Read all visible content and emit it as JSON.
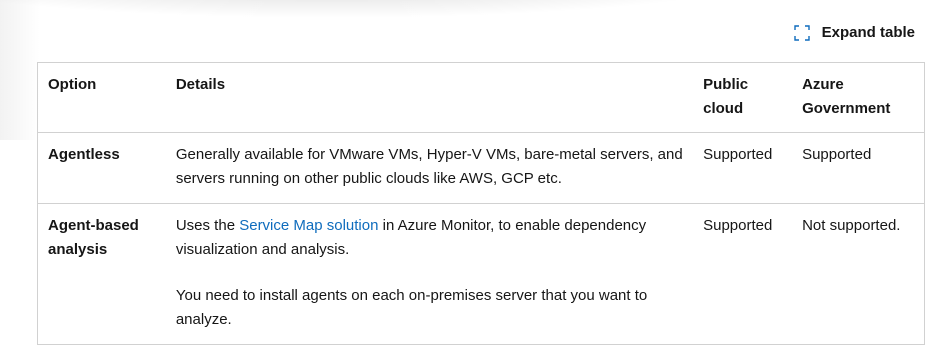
{
  "expand": {
    "label": "Expand table",
    "icon": "expand-icon"
  },
  "table": {
    "headers": {
      "option": "Option",
      "details": "Details",
      "public_cloud": "Public cloud",
      "azure_government": "Azure Government"
    },
    "rows": [
      {
        "option": "Agentless",
        "details": "Generally available for VMware VMs, Hyper-V VMs, bare-metal servers, and servers running on other public clouds like AWS, GCP etc.",
        "public_cloud": "Supported",
        "azure_government": "Supported"
      },
      {
        "option": "Agent-based analysis",
        "details_before_link": "Uses the ",
        "details_link": "Service Map solution",
        "details_after_link": " in Azure Monitor, to enable dependency visualization and analysis.",
        "details_note": "You need to install agents on each on-premises server that you want to analyze.",
        "public_cloud": "Supported",
        "azure_government": "Not supported."
      }
    ]
  },
  "colors": {
    "text": "#161616",
    "link": "#0f6cbd",
    "border": "#d1d1d1",
    "icon": "#0f6cbd"
  }
}
